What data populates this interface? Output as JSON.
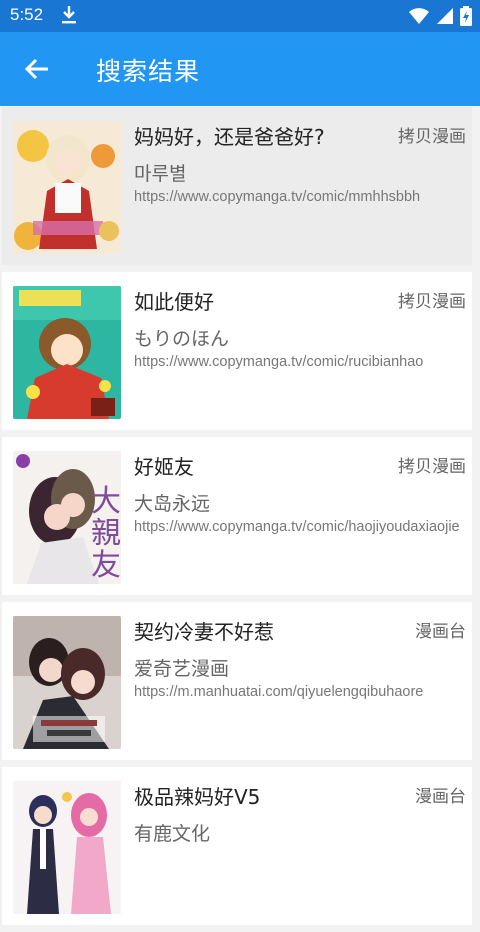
{
  "status_bar": {
    "time": "5:52"
  },
  "app_bar": {
    "title": "搜索结果"
  },
  "results": [
    {
      "title": "妈妈好，还是爸爸好?",
      "source": "拷贝漫画",
      "author": "마루별",
      "url": "https://www.copymanga.tv/comic/mmhhsbbh",
      "cover_icon": "cover-image"
    },
    {
      "title": "如此便好",
      "source": "拷贝漫画",
      "author": "もりのほん",
      "url": "https://www.copymanga.tv/comic/rucibianhao",
      "cover_icon": "cover-image"
    },
    {
      "title": "好姬友",
      "source": "拷贝漫画",
      "author": "大岛永远",
      "url": "https://www.copymanga.tv/comic/haojiyoudaxiaojie",
      "cover_icon": "cover-image"
    },
    {
      "title": "契约冷妻不好惹",
      "source": "漫画台",
      "author": "爱奇艺漫画",
      "url": "https://m.manhuatai.com/qiyuelengqibuhaore",
      "cover_icon": "cover-image"
    },
    {
      "title": "极品辣妈好V5",
      "source": "漫画台",
      "author": "有鹿文化",
      "url": "",
      "cover_icon": "cover-image"
    }
  ],
  "colors": {
    "status_bar": "#1976d2",
    "app_bar": "#2196f3",
    "pressed_card": "#ececec"
  }
}
